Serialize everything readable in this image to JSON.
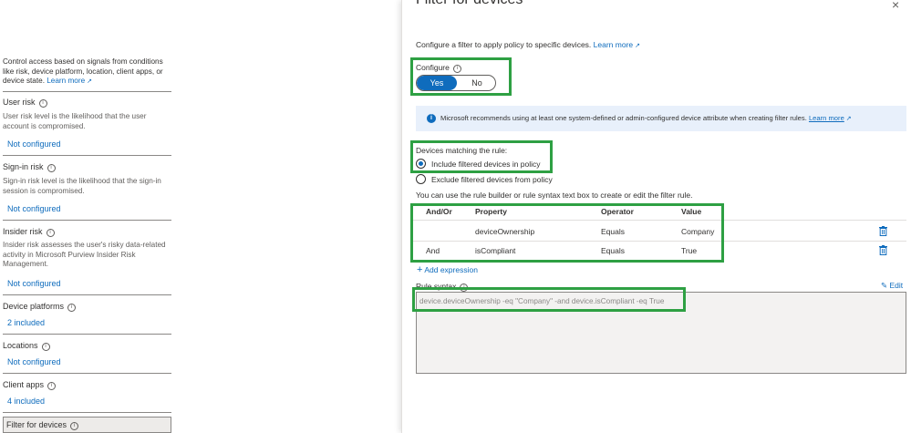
{
  "left": {
    "intro": "Control access based on signals from conditions like risk, device platform, location, client apps, or device state.",
    "intro_link": "Learn more",
    "sections": [
      {
        "title": "User risk",
        "desc": "User risk level is the likelihood that the user account is compromised.",
        "value": "Not configured"
      },
      {
        "title": "Sign-in risk",
        "desc": "Sign-in risk level is the likelihood that the sign-in session is compromised.",
        "value": "Not configured"
      },
      {
        "title": "Insider risk",
        "desc": "Insider risk assesses the user's risky data-related activity in Microsoft Purview Insider Risk Management.",
        "value": "Not configured"
      },
      {
        "title": "Device platforms",
        "value": "2 included"
      },
      {
        "title": "Locations",
        "value": "Not configured"
      },
      {
        "title": "Client apps",
        "value": "4 included"
      },
      {
        "title": "Filter for devices"
      }
    ]
  },
  "panel": {
    "title": "Filter for devices",
    "close_label": "×",
    "intro": "Configure a filter to apply policy to specific devices.",
    "intro_link": "Learn more",
    "configure_label": "Configure",
    "toggle": {
      "yes": "Yes",
      "no": "No",
      "selected": "Yes"
    },
    "banner": {
      "text": "Microsoft recommends using at least one system-defined or admin-configured device attribute when creating filter rules.",
      "link": "Learn more"
    },
    "matching_label": "Devices matching the rule:",
    "options": [
      "Include filtered devices in policy",
      "Exclude filtered devices from policy"
    ],
    "selected_option": "Include filtered devices in policy",
    "builder_hint": "You can use the rule builder or rule syntax text box to create or edit the filter rule.",
    "table": {
      "headers": [
        "And/Or",
        "Property",
        "Operator",
        "Value"
      ],
      "rows": [
        {
          "andor": "",
          "property": "deviceOwnership",
          "operator": "Equals",
          "value": "Company"
        },
        {
          "andor": "And",
          "property": "isCompliant",
          "operator": "Equals",
          "value": "True"
        }
      ]
    },
    "add_expression": "Add expression",
    "rule_syntax_label": "Rule syntax",
    "edit_label": "Edit",
    "rule_syntax": "device.deviceOwnership -eq \"Company\" -and device.isCompliant -eq True"
  },
  "colors": {
    "accent": "#0f6cbd",
    "highlight": "#2ea043",
    "banner_bg": "#e8f0fb"
  }
}
